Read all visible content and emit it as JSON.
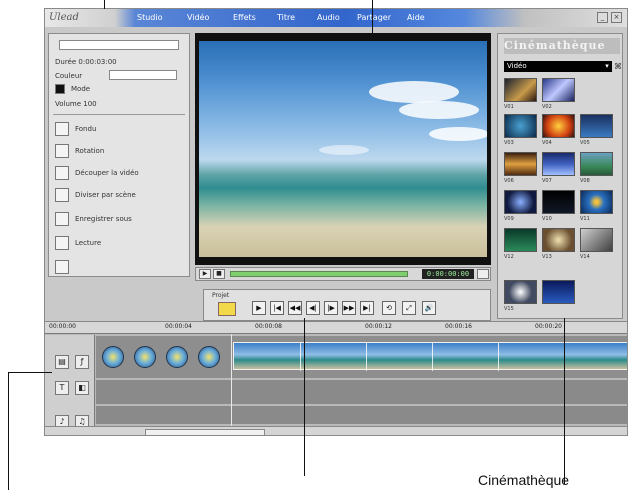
{
  "captions": {
    "library": "Cinémathèque"
  },
  "app": {
    "logo": "Ulead",
    "menu": [
      "Studio",
      "Vidéo",
      "Effets",
      "Titre",
      "Audio",
      "Partager",
      "Aide"
    ],
    "window_buttons": [
      "_",
      "×"
    ]
  },
  "tools_panel": {
    "rows": [
      "Durée 0:00:03:00",
      "Couleur",
      "Mode",
      "Volume 100",
      "Fondu",
      "Rotation",
      "Découper la vidéo",
      "Diviser par scène",
      "Enregistrer sous",
      "Lecture"
    ]
  },
  "preview": {
    "timecode": "0:00:00:00",
    "buttons": [
      "▶",
      "■"
    ]
  },
  "transport": {
    "label": "Projet",
    "buttons": [
      "▶",
      "|◀",
      "◀◀",
      "◀|",
      "|▶",
      "▶▶",
      "▶|",
      "⟲",
      "⤢",
      "🔊"
    ]
  },
  "library": {
    "title": "Cinémathèque",
    "selected_folder": "Vidéo",
    "items": [
      "V01",
      "V02",
      "V03",
      "V04",
      "V05",
      "V06",
      "V07",
      "V08",
      "V09",
      "V10",
      "V11",
      "V12",
      "V13",
      "V14",
      "V15"
    ]
  },
  "timeline": {
    "ruler": [
      "00:00:00",
      "00:00:04",
      "00:00:08",
      "00:00:12",
      "00:00:16",
      "00:00:20"
    ]
  },
  "colors": {
    "title_bar": "#3366cc",
    "scrub": "#7fcf6f",
    "timecode_text": "#9df09d"
  }
}
